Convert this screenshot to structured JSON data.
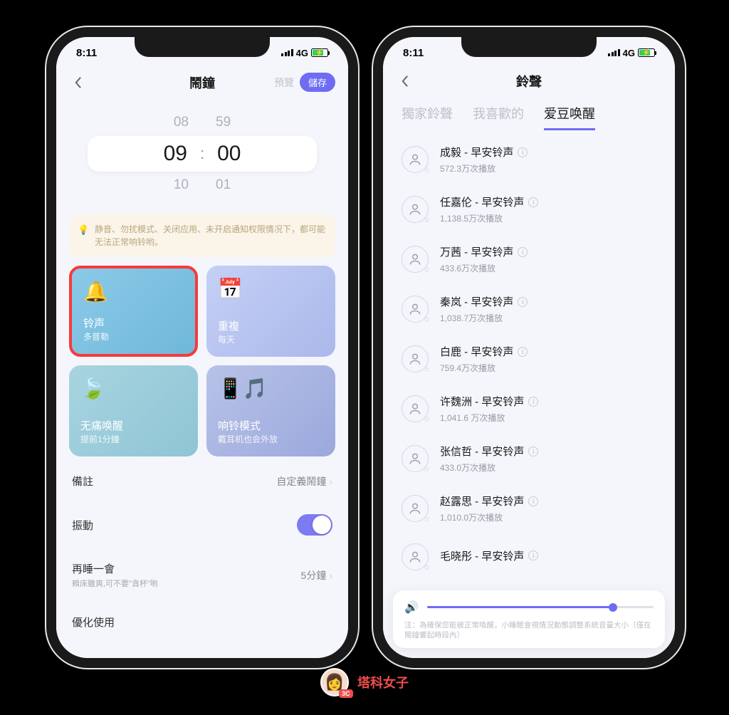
{
  "status": {
    "time": "8:11",
    "net": "4G"
  },
  "left": {
    "title": "鬧鐘",
    "preview": "預覽",
    "save": "儲存",
    "picker": {
      "prev_h": "08",
      "prev_m": "59",
      "sel_h": "09",
      "sel_m": "00",
      "next_h": "10",
      "next_m": "01",
      "colon": ":"
    },
    "tip": "静音、勿扰模式、关闭应用、未开启通知权限情况下，都可能无法正常响铃哟。",
    "card_sound": {
      "label": "铃声",
      "sub": "多普勒"
    },
    "card_repeat": {
      "label": "重複",
      "sub": "每天"
    },
    "card_wake": {
      "label": "无痛唤醒",
      "sub": "提前1分鐘"
    },
    "card_ring": {
      "label": "响铃模式",
      "sub": "戴耳机也会外放"
    },
    "rows": {
      "remark": {
        "label": "備註",
        "value": "自定義鬧鐘"
      },
      "vibrate": {
        "label": "振動"
      },
      "snooze": {
        "label": "再睡一會",
        "hint": "賴床雖爽,可不要\"貪杯\"喲",
        "value": "5分鐘"
      },
      "opt": {
        "label": "優化使用"
      }
    }
  },
  "right": {
    "title": "鈴聲",
    "tabs": {
      "a": "獨家鈴聲",
      "b": "我喜歡的",
      "c": "爱豆唤醒"
    },
    "items": [
      {
        "name": "成毅 - 早安铃声",
        "plays": "572.3万次播放"
      },
      {
        "name": "任嘉伦 - 早安铃声",
        "plays": "1,138.5万次播放"
      },
      {
        "name": "万茜 - 早安铃声",
        "plays": "433.6万次播放"
      },
      {
        "name": "秦岚 - 早安铃声",
        "plays": "1,038.7万次播放"
      },
      {
        "name": "白鹿 - 早安铃声",
        "plays": "759.4万次播放"
      },
      {
        "name": "许魏洲 - 早安铃声",
        "plays": "1,041.6 万次播放"
      },
      {
        "name": "张信哲 - 早安铃声",
        "plays": "433.0万次播放"
      },
      {
        "name": "赵露思 - 早安铃声",
        "plays": "1,010.0万次播放"
      },
      {
        "name": "毛晓彤 - 早安铃声",
        "plays": ""
      }
    ],
    "volnote": "注：為確保您能被正常喚醒，小睡眠會視情況動態調整系統音量大小（僅在鬧鐘響起時段內）"
  },
  "watermark": {
    "name": "塔科女子",
    "badge": "3C"
  }
}
